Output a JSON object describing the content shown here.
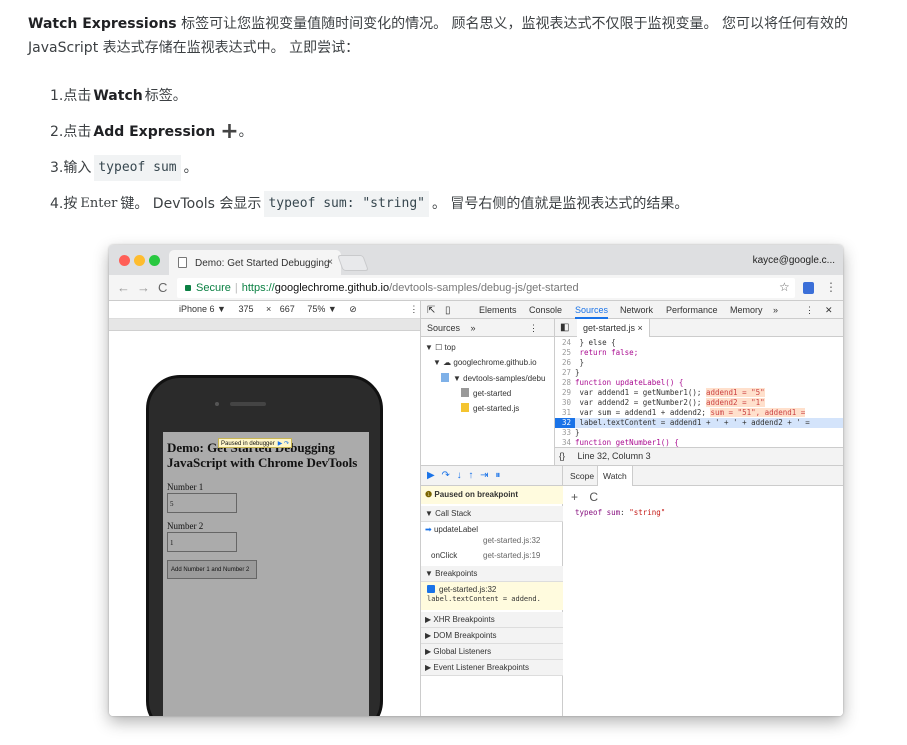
{
  "intro": {
    "title": "Watch Expressions",
    "line1": " 标签可让您监视变量值随时间变化的情况。 顾名思义，监视表达式不仅限于监视变量。 您可以将任何有效的 JavaScript 表达式存储在监视表达式中。 立即尝试："
  },
  "steps": [
    {
      "num": "1. ",
      "pre": "点击 ",
      "bold": "Watch",
      "post": " 标签。"
    },
    {
      "num": "2. ",
      "pre": "点击 ",
      "bold": "Add Expression",
      "icon": "+",
      "post": "。"
    },
    {
      "num": "3. ",
      "pre": "输入 ",
      "code": "typeof sum",
      "post": "。"
    },
    {
      "num": "4. ",
      "pre": "按 ",
      "kbd": "Enter",
      "mid": " 键。 DevTools 会显示 ",
      "code": "typeof sum: \"string\"",
      "post": "。 冒号右侧的值就是监视表达式的结果。"
    }
  ],
  "browser": {
    "tab_title": "Demo: Get Started Debugging",
    "tab_close": "×",
    "user": "kayce@google.c...",
    "nav_back": "←",
    "nav_fwd": "→",
    "nav_reload": "C",
    "secure": "Secure",
    "url_scheme": "https://",
    "url_host": "googlechrome.github.io",
    "url_path": "/devtools-samples/debug-js/get-started",
    "star": "☆",
    "menu": "⋮"
  },
  "device": {
    "model": "iPhone 6 ▼",
    "width": "375",
    "times": "×",
    "height": "667",
    "zoom": "75% ▼",
    "rotate": "⊘",
    "more": "⋮"
  },
  "page": {
    "heading": "Demo: Get Started Debugging JavaScript with Chrome DevTools",
    "paused": "Paused in debugger",
    "paused_icons": "▶ ↷",
    "label1": "Number 1",
    "value1": "5",
    "label2": "Number 2",
    "value2": "1",
    "button": "Add Number 1 and Number 2"
  },
  "devtools": {
    "tabs": [
      "Elements",
      "Console",
      "Sources",
      "Network",
      "Performance",
      "Memory",
      "»"
    ],
    "active_tab": "Sources",
    "nav_tab": "Sources",
    "nav_more": "»",
    "nav_menu": "⋮",
    "close": "✕",
    "tree": [
      "▼ ☐ top",
      "▼ ☁ googlechrome.github.io",
      "▼ devtools-samples/debu",
      "get-started",
      "get-started.js"
    ],
    "editor_tab": "get-started.js ×",
    "code": [
      {
        "ln": "24",
        "text": "  } else {"
      },
      {
        "ln": "25",
        "text": "    return false;"
      },
      {
        "ln": "26",
        "text": "  }"
      },
      {
        "ln": "27",
        "text": "}"
      },
      {
        "ln": "28",
        "text": "function updateLabel() {"
      },
      {
        "ln": "29",
        "text": "  var addend1 = getNumber1();",
        "val": "addend1 = \"5\""
      },
      {
        "ln": "30",
        "text": "  var addend2 = getNumber2();",
        "val": "addend2 = \"1\""
      },
      {
        "ln": "31",
        "text": "  var sum = addend1 + addend2;",
        "val": "sum = \"51\", addend1 ="
      },
      {
        "ln": "32",
        "text": "  label.textContent = addend1 + ' + ' + addend2 + ' ="
      },
      {
        "ln": "33",
        "text": "}"
      },
      {
        "ln": "34",
        "text": "function getNumber1() {"
      }
    ],
    "status": "Line 32, Column 3",
    "braces": "{}",
    "debug_controls": "▶ ↷ ↓ ↑ ⇥ ⏸",
    "paused_msg": "Paused on breakpoint",
    "call_stack": "▼ Call Stack",
    "frames": [
      {
        "fn": "updateLabel",
        "loc": "get-started.js:32"
      },
      {
        "fn": "onClick",
        "loc": "get-started.js:19"
      }
    ],
    "breakpoints": "▼ Breakpoints",
    "bp_file": "get-started.js:32",
    "bp_code": "label.textContent = addend.",
    "xhr": "▶ XHR Breakpoints",
    "dom": "▶ DOM Breakpoints",
    "global": "▶ Global Listeners",
    "event": "▶ Event Listener Breakpoints",
    "scope_tab": "Scope",
    "watch_tab": "Watch",
    "watch_add": "+",
    "watch_refresh": "C",
    "watch_name": "typeof sum",
    "watch_sep": ": ",
    "watch_value": "\"string\""
  },
  "colors": {
    "accent": "#1a73e8",
    "secure": "#0b8043",
    "close_dot": "#ff5f57",
    "min_dot": "#febc2e",
    "max_dot": "#28c840"
  }
}
